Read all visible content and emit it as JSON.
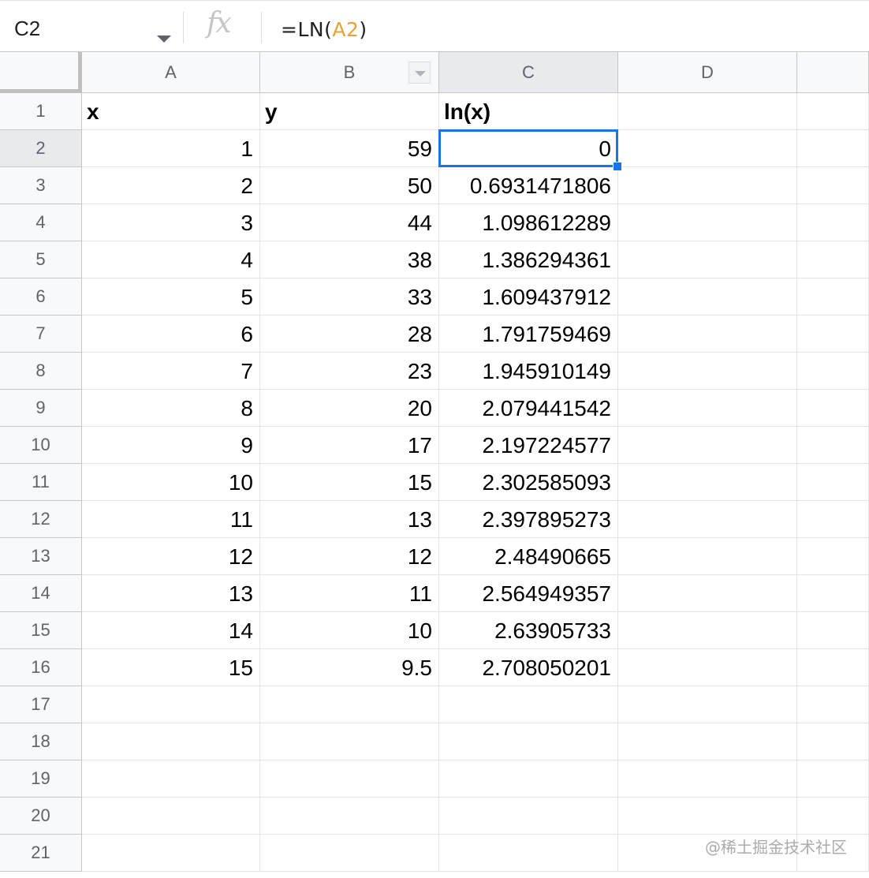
{
  "formula_bar": {
    "name_box": "C2",
    "fx_label": "fx",
    "formula_prefix": "=LN(",
    "formula_ref": "A2",
    "formula_suffix": ")"
  },
  "columns": [
    "A",
    "B",
    "C",
    "D"
  ],
  "rows": [
    "1",
    "2",
    "3",
    "4",
    "5",
    "6",
    "7",
    "8",
    "9",
    "10",
    "11",
    "12",
    "13",
    "14",
    "15",
    "16",
    "17",
    "18",
    "19",
    "20",
    "21"
  ],
  "header_row": {
    "a": "x",
    "b": "y",
    "c": "ln(x)"
  },
  "data": [
    {
      "a": "1",
      "b": "59",
      "c": "0"
    },
    {
      "a": "2",
      "b": "50",
      "c": "0.6931471806"
    },
    {
      "a": "3",
      "b": "44",
      "c": "1.098612289"
    },
    {
      "a": "4",
      "b": "38",
      "c": "1.386294361"
    },
    {
      "a": "5",
      "b": "33",
      "c": "1.609437912"
    },
    {
      "a": "6",
      "b": "28",
      "c": "1.791759469"
    },
    {
      "a": "7",
      "b": "23",
      "c": "1.945910149"
    },
    {
      "a": "8",
      "b": "20",
      "c": "2.079441542"
    },
    {
      "a": "9",
      "b": "17",
      "c": "2.197224577"
    },
    {
      "a": "10",
      "b": "15",
      "c": "2.302585093"
    },
    {
      "a": "11",
      "b": "13",
      "c": "2.397895273"
    },
    {
      "a": "12",
      "b": "12",
      "c": "2.48490665"
    },
    {
      "a": "13",
      "b": "11",
      "c": "2.564949357"
    },
    {
      "a": "14",
      "b": "10",
      "c": "2.63905733"
    },
    {
      "a": "15",
      "b": "9.5",
      "c": "2.708050201"
    }
  ],
  "selection": {
    "cell": "C2",
    "color": "#1a73e8"
  },
  "watermark": "@稀土掘金技术社区"
}
